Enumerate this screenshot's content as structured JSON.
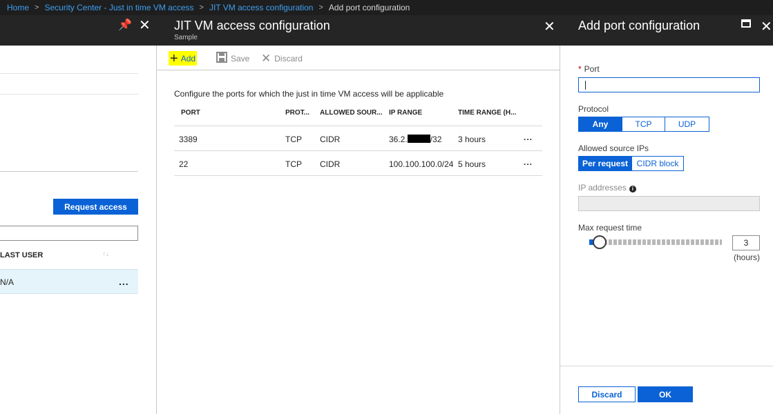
{
  "breadcrumb": {
    "items": [
      {
        "label": "Home"
      },
      {
        "label": "Security Center - Just in time VM access"
      },
      {
        "label": "JIT VM access configuration"
      },
      {
        "label": "Add port configuration"
      }
    ]
  },
  "left_blade": {
    "request_access_label": "Request access",
    "last_user_header": "LAST USER",
    "row_value": "N/A",
    "row_more": "..."
  },
  "middle_blade": {
    "title": "JIT VM access configuration",
    "subtitle": "Sample",
    "toolbar": {
      "add_label": "Add",
      "save_label": "Save",
      "discard_label": "Discard"
    },
    "intro": "Configure the ports for which the just in time VM access will be applicable",
    "columns": [
      "PORT",
      "PROT...",
      "ALLOWED SOUR...",
      "IP RANGE",
      "TIME RANGE (H..."
    ],
    "rows": [
      {
        "port": "3389",
        "protocol": "TCP",
        "source": "CIDR",
        "ip_prefix": "36.2.",
        "ip_suffix": "/32",
        "time": "3 hours",
        "more": "..."
      },
      {
        "port": "22",
        "protocol": "TCP",
        "source": "CIDR",
        "ip_prefix": "100.100.100.0/24",
        "ip_suffix": "",
        "time": "5 hours",
        "more": "..."
      }
    ]
  },
  "right_blade": {
    "title": "Add port configuration",
    "port_label": "Port",
    "port_required_mark": "*",
    "port_value": "",
    "protocol_label": "Protocol",
    "protocol_options": [
      "Any",
      "TCP",
      "UDP"
    ],
    "protocol_selected": "Any",
    "source_label": "Allowed source IPs",
    "source_options": [
      "Per request",
      "CIDR block"
    ],
    "source_selected": "Per request",
    "ip_label": "IP addresses",
    "ip_value": "",
    "max_time_label": "Max request time",
    "max_time_value": "3",
    "max_time_unit": "(hours)",
    "discard_label": "Discard",
    "ok_label": "OK"
  },
  "colors": {
    "accent": "#0a62d6",
    "header_bg": "#252525",
    "link": "#3ea0f2",
    "highlight": "#ffff00"
  }
}
